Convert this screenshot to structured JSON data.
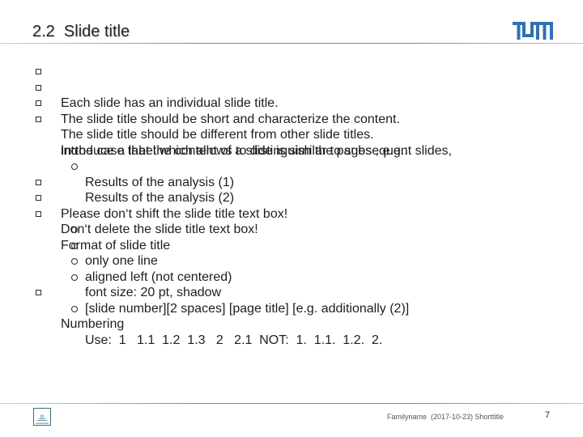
{
  "header": {
    "title": "2.2  Slide title",
    "logo": "TUM",
    "brand_color": "#3070b3"
  },
  "bullets": [
    {
      "level": 1,
      "text": "Each slide has an individual slide title."
    },
    {
      "level": 1,
      "text": "The slide title should be short and characterize the content."
    },
    {
      "level": 1,
      "text": "The slide title should be different from other slide titles."
    },
    {
      "level": 1,
      "text": "In the case that the content of a slide is similar to subsequent slides,"
    },
    {
      "level": 0,
      "text": "introduce a label which allows to distinguish the pages , e.g.:"
    },
    {
      "level": 2,
      "text": "Results of the analysis (1)"
    },
    {
      "level": 2,
      "text": "Results of the analysis (2)"
    },
    {
      "level": 1,
      "text": "Please don‘t shift the slide title text box!"
    },
    {
      "level": 1,
      "text": "Don‘t delete the slide title text box!"
    },
    {
      "level": 1,
      "text": "Format of slide title"
    },
    {
      "level": 2,
      "text": "only one line"
    },
    {
      "level": 2,
      "text": "aligned left (not centered)"
    },
    {
      "level": 2,
      "text": "font size: 20 pt, shadow"
    },
    {
      "level": 2,
      "text": "[slide number][2 spaces] [page title] [e.g. additionally (2)]"
    },
    {
      "level": 1,
      "text": "Numbering"
    },
    {
      "level": 2,
      "text": "Use:  1   1.1  1.2  1.3   2   2.1  NOT:  1.  1.1.  1.2.  2."
    }
  ],
  "footer": {
    "text": "Familyname  (2017-10-23) Shorttitle",
    "page_number": "7",
    "icon": "presentation-icon"
  }
}
